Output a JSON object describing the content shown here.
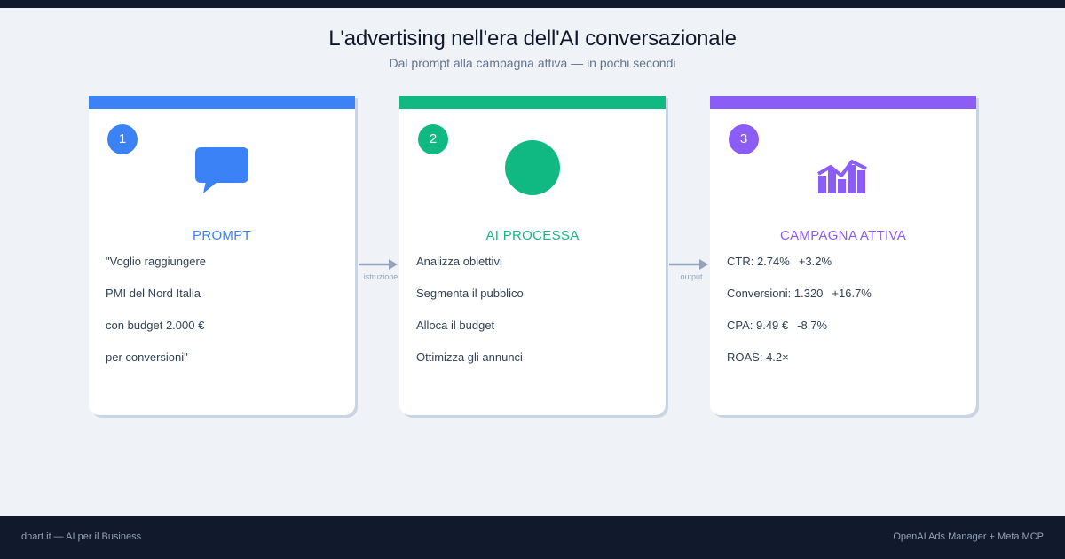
{
  "header": {
    "title": "L'advertising nell'era dell'AI conversazionale",
    "subtitle": "Dal prompt alla campagna attiva — in pochi secondi"
  },
  "colors": {
    "blue": "#3b82f6",
    "green": "#10b981",
    "purple": "#8b5cf6",
    "positive": "#10b981",
    "negative": "#ef4444"
  },
  "steps": [
    {
      "number": "1",
      "icon": "speech-bubble-icon",
      "heading": "PROMPT",
      "lines": [
        "\"Voglio raggiungere",
        "PMI del Nord Italia",
        "con budget 2.000 €",
        "per conversioni\""
      ]
    },
    {
      "number": "2",
      "icon": "circle-icon",
      "heading": "AI PROCESSA",
      "lines": [
        "Analizza obiettivi",
        "Segmenta il pubblico",
        "Alloca il budget",
        "Ottimizza gli annunci"
      ]
    },
    {
      "number": "3",
      "icon": "bar-chart-icon",
      "heading": "CAMPAGNA ATTIVA",
      "metrics": [
        {
          "label": "CTR: 2.74%",
          "delta": "+3.2%",
          "tone": "positive"
        },
        {
          "label": "Conversioni: 1.320",
          "delta": "+16.7%",
          "tone": "positive"
        },
        {
          "label": "CPA: 9.49 €",
          "delta": "-8.7%",
          "tone": "negative"
        },
        {
          "label": "ROAS: 4.2×",
          "delta": "",
          "tone": "neutral"
        }
      ]
    }
  ],
  "connectors": [
    "istruzione",
    "output"
  ],
  "footer": {
    "left": "dnart.it — AI per il Business",
    "right": "OpenAI Ads Manager + Meta MCP"
  }
}
